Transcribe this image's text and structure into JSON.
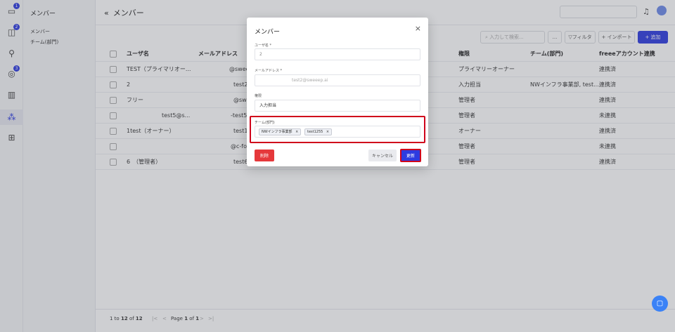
{
  "rail": {
    "badges": [
      "1",
      "2",
      "3"
    ]
  },
  "subnav": {
    "title": "メンバー",
    "items": [
      "メンバー",
      "チーム(部門)"
    ]
  },
  "header": {
    "title": "メンバー"
  },
  "toolbar": {
    "search_placeholder": "入力して検索...",
    "more_label": "...",
    "filter_label": "フィルタ",
    "import_label": "+ インポート",
    "add_label": "+ 追加"
  },
  "table": {
    "columns": [
      "ユーザ名",
      "メールアドレス",
      "権限",
      "チーム(部門)",
      "freeeアカウント連携"
    ],
    "rows": [
      {
        "name": "TEST（プライマリオー...",
        "email": "@swee",
        "role": "プライマリーオーナー",
        "team": "",
        "link": "連携済"
      },
      {
        "name": "2",
        "email": "test2(",
        "role": "入力担当",
        "team": "NWインフラ事業部, test...",
        "link": "連携済"
      },
      {
        "name": "フリー",
        "email": "@swe",
        "role": "管理者",
        "team": "",
        "link": "連携済"
      },
      {
        "name": "test5@s...",
        "email": "-test54",
        "role": "管理者",
        "team": "",
        "link": "未連携"
      },
      {
        "name": "1test（オーナー）",
        "email": "test15",
        "role": "オーナー",
        "team": "",
        "link": "連携済"
      },
      {
        "name": "",
        "email": "@c-fo.",
        "role": "管理者",
        "team": "",
        "link": "未連携"
      },
      {
        "name": "6　（管理者）",
        "email": "test6(",
        "role": "管理者",
        "team": "",
        "link": "連携済"
      }
    ]
  },
  "pagination": {
    "range_prefix": "1 to",
    "range_end": "12",
    "of": "of",
    "total": "12",
    "page_label": "Page",
    "page": "1",
    "pages": "1",
    "first": "|<",
    "prev": "<",
    "next": ">",
    "last": ">|"
  },
  "modal": {
    "title": "メンバー",
    "close": "×",
    "username_label": "ユーザ名 *",
    "username_value": "2",
    "email_label": "メールアドレス *",
    "email_value": "test2@sweeep.ai",
    "role_label": "権限",
    "role_value": "入力担当",
    "team_label": "チーム(部門)",
    "team_chips": [
      "NWインフラ事業部",
      "test1255"
    ],
    "chip_remove": "×",
    "delete_label": "削除",
    "cancel_label": "キャンセル",
    "update_label": "更新"
  }
}
